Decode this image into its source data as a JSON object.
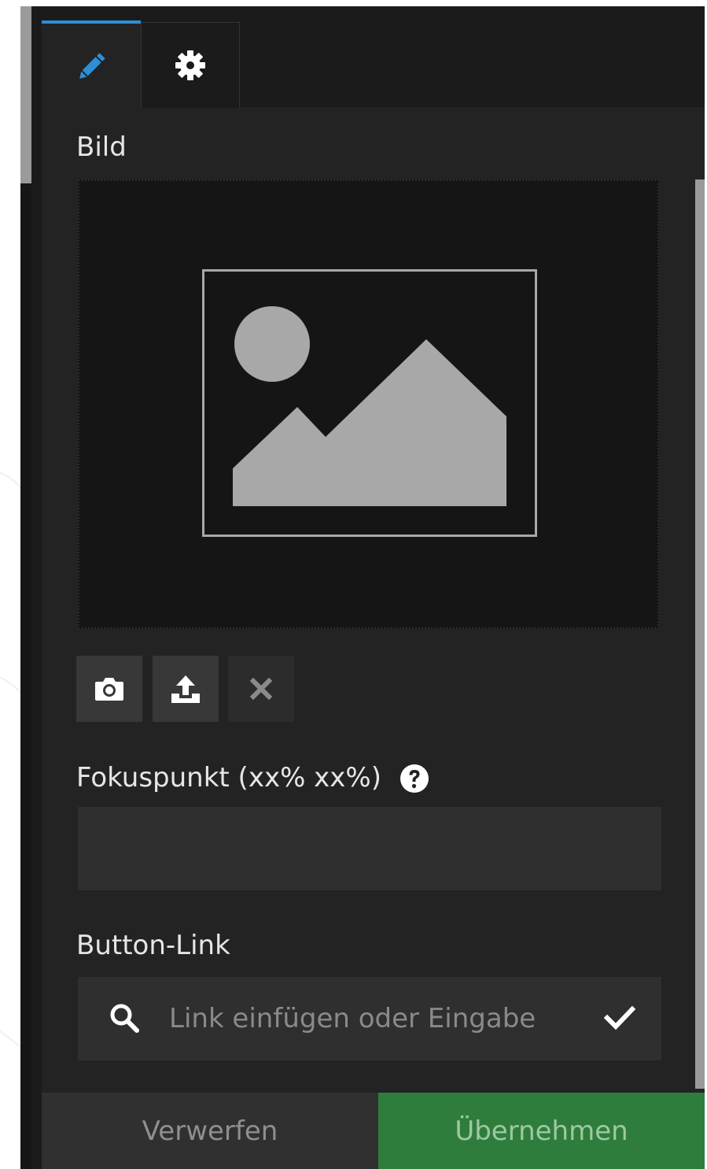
{
  "tabs": [
    {
      "name": "edit",
      "icon": "pencil-icon",
      "active": true,
      "accent": "#2d8fd6"
    },
    {
      "name": "settings",
      "icon": "gear-icon",
      "active": false
    }
  ],
  "image_field": {
    "label": "Bild",
    "placeholder_icon": "image-placeholder-icon",
    "actions": [
      {
        "icon": "camera-icon"
      },
      {
        "icon": "upload-icon"
      },
      {
        "icon": "close-icon"
      }
    ]
  },
  "focus_field": {
    "label": "Fokuspunkt (xx% xx%)",
    "help_icon": "help-icon",
    "value": ""
  },
  "link_field": {
    "label": "Button-Link",
    "placeholder": "Link einfügen oder Eingabe",
    "search_icon": "search-icon",
    "confirm_icon": "checkmark-icon"
  },
  "footer": {
    "discard_label": "Verwerfen",
    "apply_label": "Übernehmen",
    "apply_color": "#2f7d3c"
  }
}
